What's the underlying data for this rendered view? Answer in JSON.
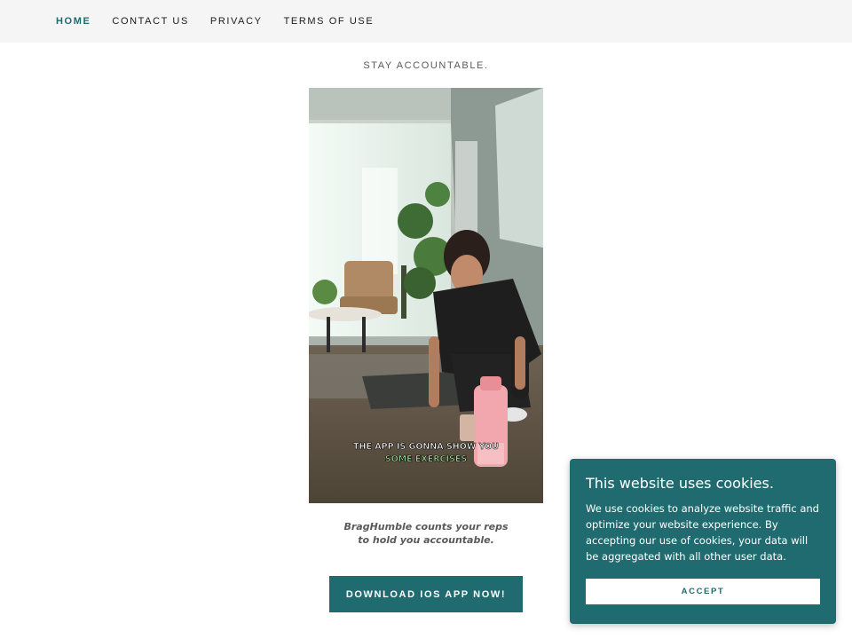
{
  "nav": {
    "items": [
      {
        "label": "HOME",
        "active": true
      },
      {
        "label": "CONTACT US",
        "active": false
      },
      {
        "label": "PRIVACY",
        "active": false
      },
      {
        "label": "TERMS OF USE",
        "active": false
      }
    ]
  },
  "hero": {
    "tagline": "STAY ACCOUNTABLE.",
    "video_subtitle_line1": "THE APP IS GONNA SHOW YOU",
    "video_subtitle_line2": "SOME EXERCISES",
    "caption_line1": "BragHumble counts your reps",
    "caption_line2": "to hold you accountable.",
    "download_label": "DOWNLOAD IOS APP NOW!"
  },
  "cookie_banner": {
    "title": "This website uses cookies.",
    "text": "We use cookies to analyze website traffic and optimize your website experience. By accepting our use of cookies, your data will be aggregated with all other user data.",
    "accept_label": "ACCEPT"
  },
  "colors": {
    "brand": "#1f6b70",
    "nav_background": "#f5f5f5",
    "subtitle_highlight": "#9fe39a"
  }
}
